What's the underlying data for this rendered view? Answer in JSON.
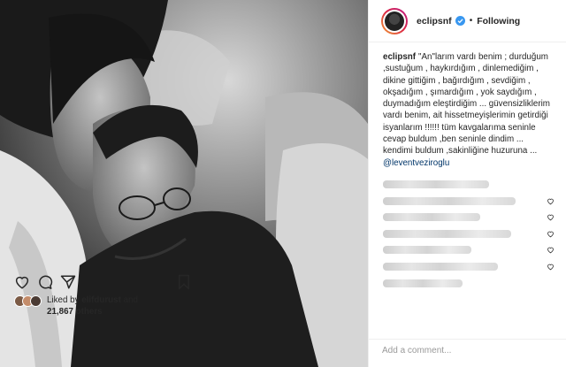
{
  "post": {
    "username": "eclipsnf",
    "follow_separator": "•",
    "follow_label": "Following",
    "caption_lines": [
      "\"An\"larım vardı benim ; durduğum",
      ",sustuğum , haykırdığım , dinlemediğim ,",
      "dikine gittiğim , bağırdığım , sevdiğim ,",
      "okşadığım , şımardığım , yok saydığım ,",
      "duymadığım eleştirdiğim ... güvensizliklerim",
      "vardı benim, ait hissetmeyişlerimin getirdiği",
      "isyanlarım !!!!!! tüm kavgalarıma seninle",
      "cevap buldum ,ben seninle dindim ...",
      "kendimi buldum ,sakinliğine huzuruna ..."
    ],
    "mention": "@leventveziroglu",
    "liked_by_prefix": "Liked by ",
    "liked_by_user": "elifdurust",
    "liked_by_suffix": " and",
    "likes_count": "21,867 others",
    "add_comment_placeholder": "Add a comment..."
  },
  "icons": {
    "verified": "verified-badge-icon",
    "heart": "heart-icon",
    "comment": "comment-icon",
    "share": "share-icon",
    "bookmark": "bookmark-icon"
  },
  "colors": {
    "text": "#262626",
    "link": "#003569",
    "verified": "#3897f0",
    "placeholder": "#999999"
  }
}
